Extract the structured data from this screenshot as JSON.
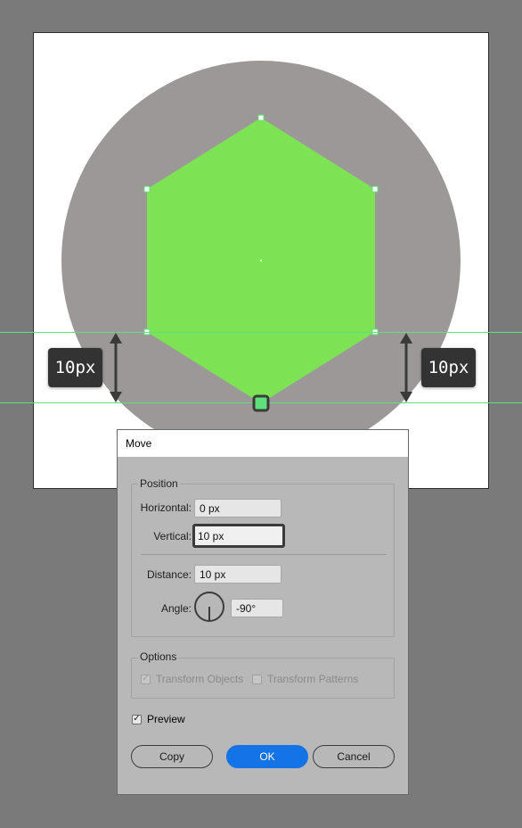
{
  "canvas": {
    "measurements": {
      "left_label": "10px",
      "right_label": "10px"
    },
    "colors": {
      "background": "#7a7a7a",
      "artboard": "#ffffff",
      "circle": "#9d9898",
      "hexagon": "#7de355",
      "guide": "#5ee07a"
    }
  },
  "dialog": {
    "title": "Move",
    "position": {
      "group_title": "Position",
      "horizontal_label": "Horizontal:",
      "horizontal_value": "0 px",
      "vertical_label": "Vertical:",
      "vertical_value": "10 px",
      "distance_label": "Distance:",
      "distance_value": "10 px",
      "angle_label": "Angle:",
      "angle_value": "-90°"
    },
    "options": {
      "group_title": "Options",
      "transform_objects_label": "Transform Objects",
      "transform_objects_checked": true,
      "transform_patterns_label": "Transform Patterns",
      "transform_patterns_checked": false
    },
    "preview_label": "Preview",
    "preview_checked": true,
    "buttons": {
      "copy": "Copy",
      "ok": "OK",
      "cancel": "Cancel"
    },
    "colors": {
      "dialog_bg": "#b8b8b8",
      "primary_button": "#1473e6"
    }
  }
}
